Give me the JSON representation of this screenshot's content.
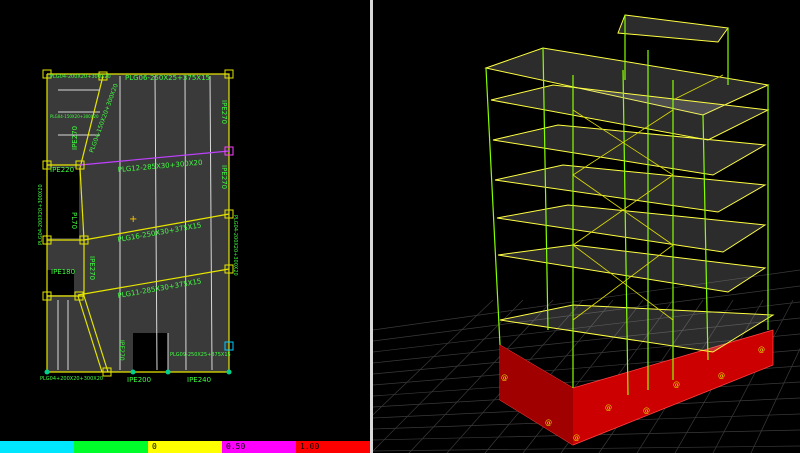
{
  "plan": {
    "labels": {
      "top_beam": "PLG06-250X25+375X15",
      "top_left_beam": "PLG04-200X20+300X20",
      "diag_beam": "PLG04-150X20+300X20",
      "left_col_1": "IPE270",
      "left_col_2": "IPE220",
      "left_col_3": "PLG04-200X20+300X20",
      "center_diag": "PLG12-285X30+300X20",
      "mid_beam": "PLG16-250X30+375X15",
      "lower_beam": "PLG11-285X30+375X15",
      "right_col_1": "IPE270",
      "right_col_2": "IPE270",
      "right_col_3": "PLG04-200X20+300X20",
      "ipe180": "IPE180",
      "ipe270_lower": "IPE270",
      "pl70": "PL70",
      "bottom_left": "PLG04+200X20+300X20",
      "bottom_right": "PLG09-250X25+375X15",
      "ipe200": "IPE200",
      "ipe240": "IPE240",
      "ipe270_bottom": "IPE270",
      "small_note": "PLG04-150X20+300X20"
    }
  },
  "scale": {
    "colors": [
      "#00e6ff",
      "#00ff2a",
      "#ffff00",
      "#ff00ff",
      "#ff0000"
    ],
    "labels": [
      "0",
      "0.50",
      "1.00"
    ]
  },
  "view3d": {
    "base_color": "#cc0000",
    "frame_color": "#88ff00",
    "slab_color": "#ffff44"
  }
}
